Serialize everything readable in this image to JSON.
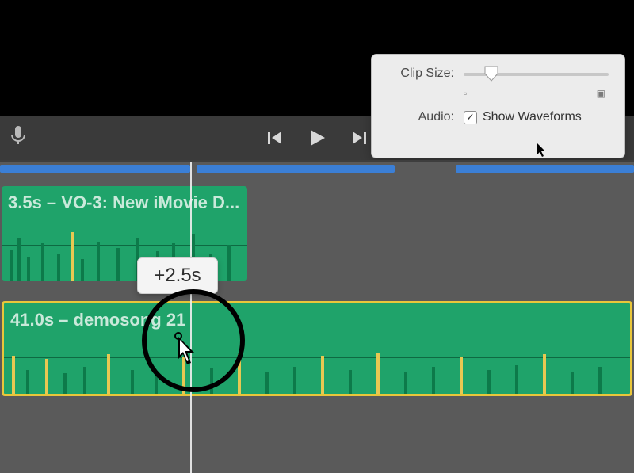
{
  "popover": {
    "clip_size_label": "Clip Size:",
    "audio_label": "Audio:",
    "show_waveforms_label": "Show Waveforms",
    "show_waveforms_checked": true,
    "small_thumb_glyph": "▫",
    "large_thumb_glyph": "▣"
  },
  "controls": {
    "mic_glyph": "🎤"
  },
  "timeline": {
    "clip1_title": "3.5s – VO-3: New iMovie D...",
    "clip2_title": "41.0s – demosong 21",
    "tooltip_text": "+2.5s"
  }
}
